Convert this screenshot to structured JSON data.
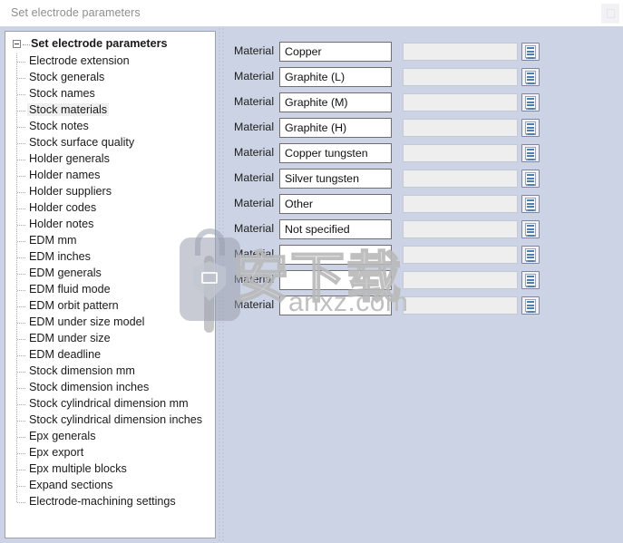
{
  "window": {
    "title": "Set electrode parameters",
    "close_button_icon": "window-button-icon"
  },
  "tree": {
    "root": {
      "label": "Set electrode parameters",
      "expanded": true,
      "expander_icon": "collapse-box-icon"
    },
    "items": [
      {
        "label": "Electrode extension",
        "selected": false
      },
      {
        "label": "Stock generals",
        "selected": false
      },
      {
        "label": "Stock names",
        "selected": false
      },
      {
        "label": "Stock materials",
        "selected": true
      },
      {
        "label": "Stock notes",
        "selected": false
      },
      {
        "label": "Stock surface quality",
        "selected": false
      },
      {
        "label": "Holder generals",
        "selected": false
      },
      {
        "label": "Holder names",
        "selected": false
      },
      {
        "label": "Holder suppliers",
        "selected": false
      },
      {
        "label": "Holder codes",
        "selected": false
      },
      {
        "label": "Holder notes",
        "selected": false
      },
      {
        "label": "EDM mm",
        "selected": false
      },
      {
        "label": "EDM inches",
        "selected": false
      },
      {
        "label": "EDM generals",
        "selected": false
      },
      {
        "label": "EDM fluid mode",
        "selected": false
      },
      {
        "label": "EDM orbit pattern",
        "selected": false
      },
      {
        "label": "EDM under size model",
        "selected": false
      },
      {
        "label": "EDM under size",
        "selected": false
      },
      {
        "label": "EDM deadline",
        "selected": false
      },
      {
        "label": "Stock dimension mm",
        "selected": false
      },
      {
        "label": "Stock dimension inches",
        "selected": false
      },
      {
        "label": "Stock cylindrical dimension mm",
        "selected": false
      },
      {
        "label": "Stock cylindrical dimension inches",
        "selected": false
      },
      {
        "label": "Epx generals",
        "selected": false
      },
      {
        "label": "Epx export",
        "selected": false
      },
      {
        "label": "Epx multiple blocks",
        "selected": false
      },
      {
        "label": "Expand sections",
        "selected": false
      },
      {
        "label": "Electrode-machining settings",
        "selected": false
      }
    ],
    "scrollbar": {
      "name": "tree-vertical-scrollbar"
    }
  },
  "form": {
    "row_label": "Material",
    "icon_name": "list-editor-icon",
    "rows": [
      {
        "label": "Material",
        "primary": "Copper",
        "secondary": ""
      },
      {
        "label": "Material",
        "primary": "Graphite (L)",
        "secondary": ""
      },
      {
        "label": "Material",
        "primary": "Graphite (M)",
        "secondary": ""
      },
      {
        "label": "Material",
        "primary": "Graphite (H)",
        "secondary": ""
      },
      {
        "label": "Material",
        "primary": "Copper tungsten",
        "secondary": ""
      },
      {
        "label": "Material",
        "primary": "Silver tungsten",
        "secondary": ""
      },
      {
        "label": "Material",
        "primary": "Other",
        "secondary": ""
      },
      {
        "label": "Material",
        "primary": "Not specified",
        "secondary": ""
      },
      {
        "label": "Material",
        "primary": "",
        "secondary": ""
      },
      {
        "label": "Material",
        "primary": "",
        "secondary": ""
      },
      {
        "label": "Material",
        "primary": "",
        "secondary": ""
      }
    ]
  },
  "watermark": {
    "cn_text": "安下载",
    "domain_text": "anxz.com"
  },
  "colors": {
    "pane_background": "#ccd3e4",
    "window_background": "#ffffff",
    "title_text": "#8e8e8e",
    "input_border": "#6f6f6f",
    "readonly_fill": "#eeeeee",
    "icon_accent": "#4a7ebb",
    "selection_fill": "#efefef"
  }
}
